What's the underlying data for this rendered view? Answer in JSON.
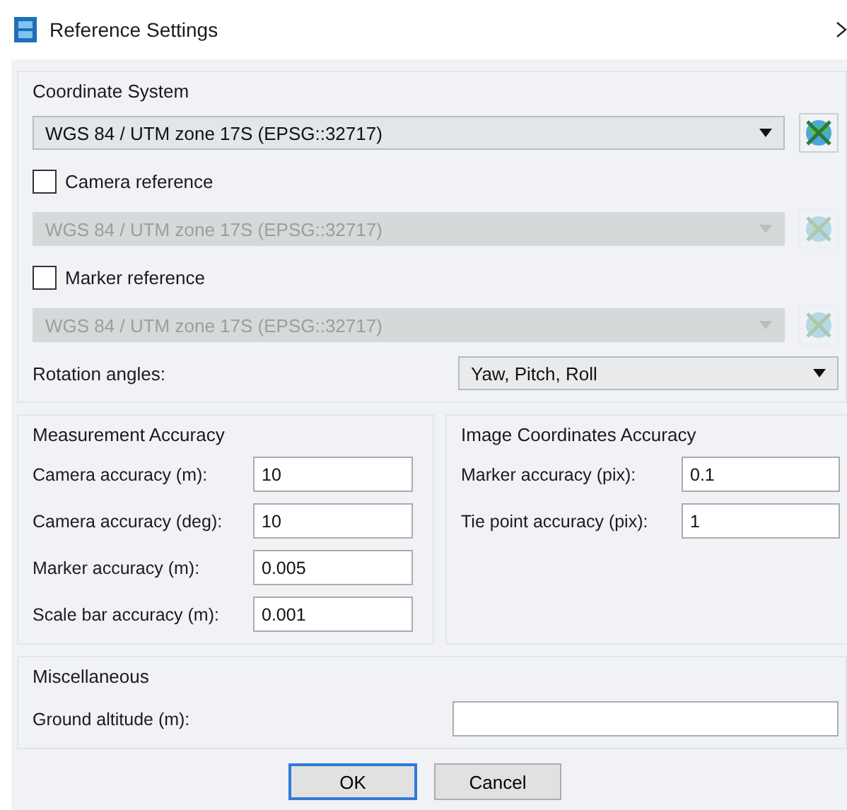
{
  "window": {
    "title": "Reference Settings"
  },
  "coordinate_system": {
    "title": "Coordinate System",
    "crs": {
      "value": "WGS 84 / UTM zone 17S (EPSG::32717)",
      "disabled": false
    },
    "references": [
      {
        "label": "Camera reference",
        "checked": false,
        "crs": {
          "value": "WGS 84 / UTM zone 17S (EPSG::32717)",
          "disabled": true
        }
      },
      {
        "label": "Marker reference",
        "checked": false,
        "crs": {
          "value": "WGS 84 / UTM zone 17S (EPSG::32717)",
          "disabled": true
        }
      }
    ],
    "rotation": {
      "label": "Rotation angles:",
      "value": "Yaw, Pitch, Roll"
    }
  },
  "measurement_accuracy": {
    "title": "Measurement Accuracy",
    "fields": [
      {
        "label": "Camera accuracy (m):",
        "value": "10"
      },
      {
        "label": "Camera accuracy (deg):",
        "value": "10"
      },
      {
        "label": "Marker accuracy (m):",
        "value": "0.005"
      },
      {
        "label": "Scale bar accuracy (m):",
        "value": "0.001"
      }
    ]
  },
  "image_accuracy": {
    "title": "Image Coordinates Accuracy",
    "fields": [
      {
        "label": "Marker accuracy (pix):",
        "value": "0.1"
      },
      {
        "label": "Tie point accuracy (pix):",
        "value": "1"
      }
    ]
  },
  "miscellaneous": {
    "title": "Miscellaneous",
    "fields": [
      {
        "label": "Ground altitude (m):"
      }
    ]
  },
  "buttons": [
    {
      "label": "OK",
      "default": true
    },
    {
      "label": "Cancel",
      "default": false
    }
  ]
}
